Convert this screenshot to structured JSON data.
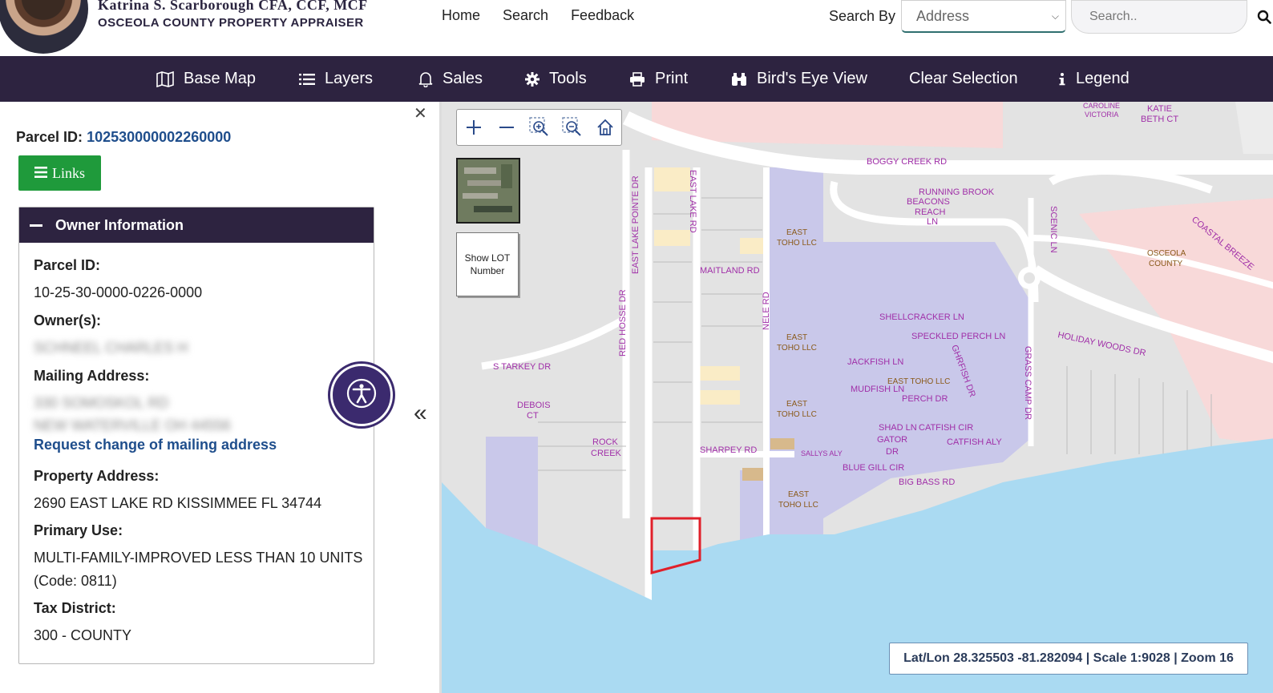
{
  "header": {
    "name": "Katrina S. Scarborough CFA, CCF, MCF",
    "office": "OSCEOLA COUNTY PROPERTY APPRAISER",
    "nav": [
      "Home",
      "Search",
      "Feedback"
    ],
    "search_by_label": "Search By",
    "search_by_value": "Address",
    "search_placeholder": "Search.."
  },
  "toolbar": [
    {
      "label": "Base Map",
      "icon": "map-icon"
    },
    {
      "label": "Layers",
      "icon": "layers-icon"
    },
    {
      "label": "Sales",
      "icon": "bell-icon"
    },
    {
      "label": "Tools",
      "icon": "gear-icon"
    },
    {
      "label": "Print",
      "icon": "printer-icon"
    },
    {
      "label": "Bird's Eye View",
      "icon": "binoculars-icon"
    },
    {
      "label": "Clear Selection",
      "icon": ""
    },
    {
      "label": "Legend",
      "icon": "info-icon"
    }
  ],
  "panel": {
    "parcel_id_label": "Parcel ID:",
    "parcel_id": "102530000002260000",
    "links_label": "Links",
    "owner_title": "Owner Information",
    "fields": {
      "parcel_label": "Parcel ID:",
      "parcel_value": "10-25-30-0000-0226-0000",
      "owners_label": "Owner(s):",
      "owners_value": "SCHNEEL CHARLES H",
      "mailing_label": "Mailing Address:",
      "mailing_line1": "330 SOMOSKOL RD",
      "mailing_line2": "NEW WATERVILLE OH 44556",
      "request_change": "Request change of mailing address",
      "property_label": "Property Address:",
      "property_value": "2690 EAST LAKE RD KISSIMMEE FL 34744",
      "use_label": "Primary Use:",
      "use_value": "MULTI-FAMILY-IMPROVED LESS THAN 10 UNITS",
      "use_code": "(Code: 0811)",
      "tax_label": "Tax District:",
      "tax_value": "300 - COUNTY"
    }
  },
  "map": {
    "show_lot": "Show LOT Number",
    "status": "Lat/Lon 28.325503 -81.282094 | Scale 1:9028 | Zoom 16",
    "labels": {
      "boggy": "BOGGY CREEK RD",
      "running": "RUNNING BROOK",
      "beacons": "BEACONS",
      "reach": "REACH",
      "ln": "LN",
      "maitland": "MAITLAND RD",
      "east_lake_rd": "EAST LAKE RD",
      "east_lake_pointe": "EAST LAKE POINTE DR",
      "nele": "NELE RD",
      "shellcracker": "SHELLCRACKER LN",
      "speckled": "SPECKLED PERCH LN",
      "jackfish": "JACKFISH LN",
      "mudfish": "MUDFISH LN",
      "perch": "PERCH DR",
      "shad": "SHAD LN",
      "gator": "GATOR",
      "dr": "DR",
      "catfish_cir": "CATFISH CIR",
      "catfish_aly": "CATFISH ALY",
      "blue_gill": "BLUE GILL CIR",
      "big_bass": "BIG BASS RD",
      "holiday": "HOLIDAY WOODS DR",
      "starkey": "S TARKEY DR",
      "debois": "DEBOIS",
      "ct": "CT",
      "rock": "ROCK",
      "creek": "CREEK",
      "sharpey": "SHARPEY RD",
      "sallys": "SALLYS ALY",
      "osceola": "OSCEOLA",
      "county": "COUNTY",
      "caroline": "CAROLINE",
      "victoria": "VICTORIA",
      "katie": "KATIE",
      "beth": "BETH CT",
      "coastal": "COASTAL BREEZE",
      "grass_camp": "GRASS CAMP DR",
      "east_toho": "EAST",
      "toho_llc": "TOHO LLC",
      "east_toho_llc": "EAST TOHO LLC",
      "red_horse": "RED HOSSE DR",
      "scenic": "SCENIC LN",
      "ghrfish": "GHRFISH DR"
    }
  },
  "colors": {
    "brand_dark": "#2d2340",
    "link_blue": "#1f4e8c",
    "links_green": "#1f9a3b",
    "accessibility": "#3b2a6e",
    "water": "#aadaf2",
    "parcel_grey": "#e3e3e3",
    "parcel_lavender": "#c9c8ea",
    "parcel_pink": "#f8d9d9",
    "parcel_yellow": "#faecc6",
    "selection_red": "#e0202a"
  }
}
